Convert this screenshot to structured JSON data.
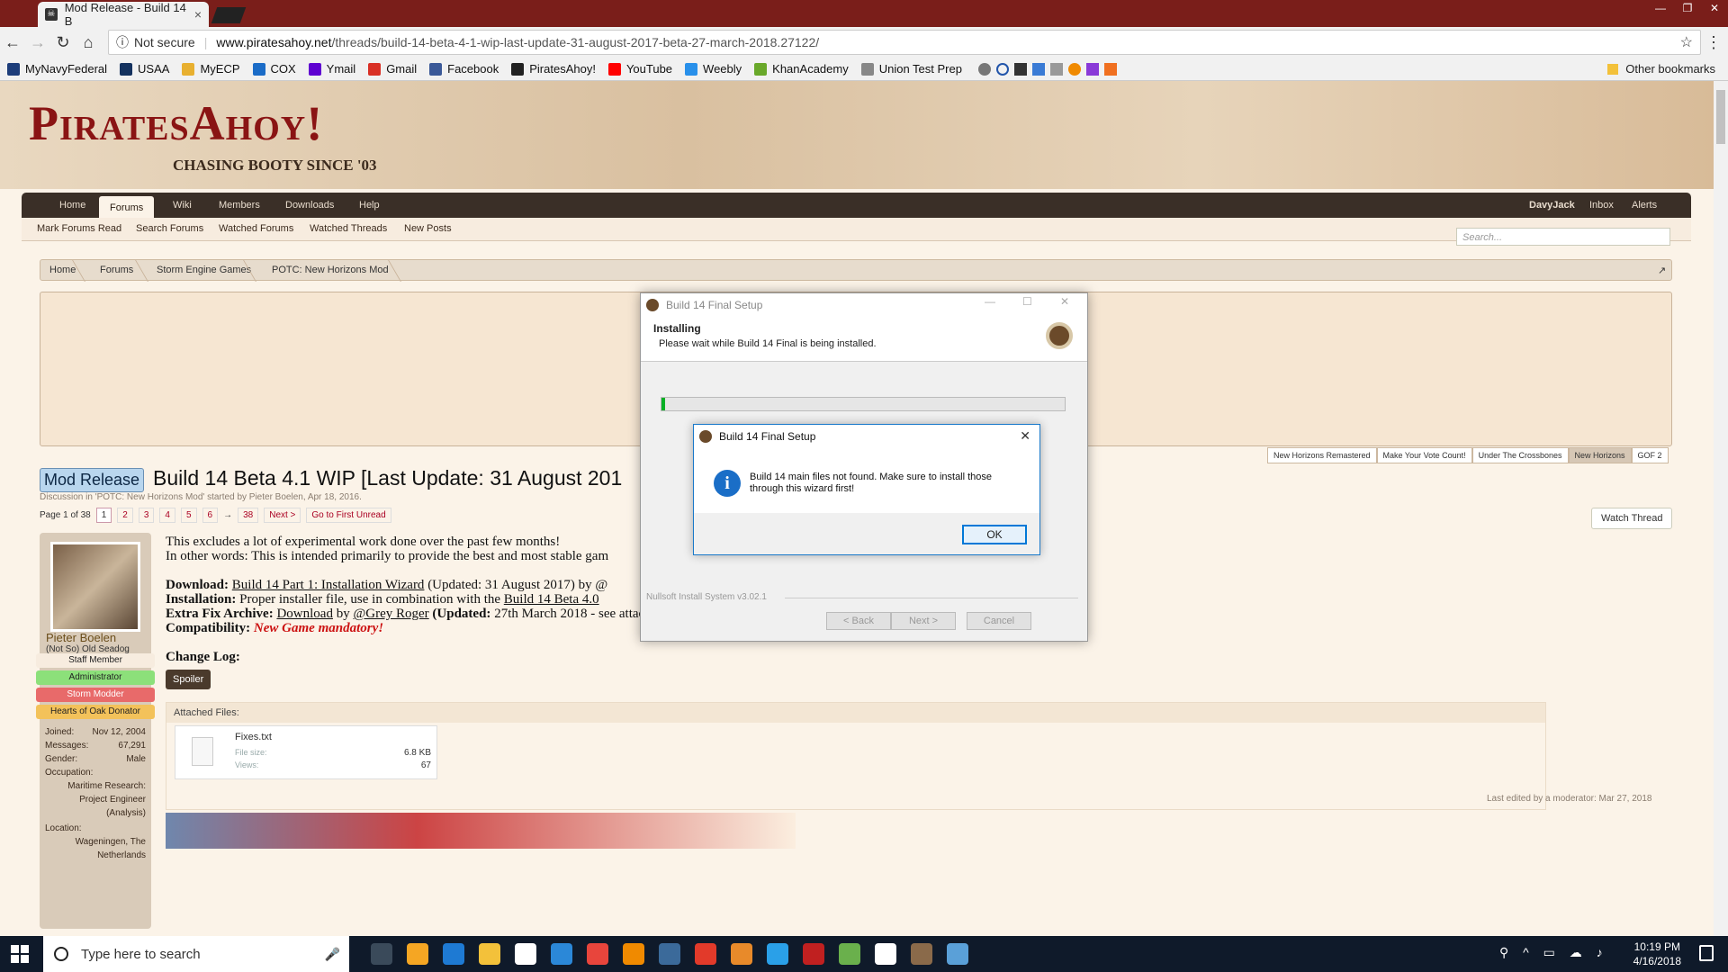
{
  "browser": {
    "tab_title": "Mod Release - Build 14 B",
    "security": "Not secure",
    "url_domain": "www.piratesahoy.net",
    "url_path": "/threads/build-14-beta-4-1-wip-last-update-31-august-2017-beta-27-march-2018.27122/",
    "bookmarks": [
      {
        "label": "MyNavyFederal",
        "color": "#1d3d7a"
      },
      {
        "label": "USAA",
        "color": "#14325f"
      },
      {
        "label": "MyECP",
        "color": "#e8b030"
      },
      {
        "label": "COX",
        "color": "#1b6cc7"
      },
      {
        "label": "Ymail",
        "color": "#5f01d1"
      },
      {
        "label": "Gmail",
        "color": "#d93025"
      },
      {
        "label": "Facebook",
        "color": "#3b5998"
      },
      {
        "label": "PiratesAhoy!",
        "color": "#222222"
      },
      {
        "label": "YouTube",
        "color": "#ff0000"
      },
      {
        "label": "Weebly",
        "color": "#2990ea"
      },
      {
        "label": "KhanAcademy",
        "color": "#69a82a"
      },
      {
        "label": "Union Test Prep",
        "color": "#888888"
      }
    ],
    "other_bookmarks": "Other bookmarks"
  },
  "site": {
    "logo": "PiratesAhoy!",
    "tagline": "CHASING BOOTY SINCE '03",
    "nav": [
      "Home",
      "Forums",
      "Wiki",
      "Members",
      "Downloads",
      "Help"
    ],
    "active_nav": "Forums",
    "user_nav": [
      "DavyJack",
      "Inbox",
      "Alerts"
    ],
    "subnav": [
      "Mark Forums Read",
      "Search Forums",
      "Watched Forums",
      "Watched Threads",
      "New Posts"
    ],
    "search_placeholder": "Search...",
    "breadcrumbs": [
      "Home",
      "Forums",
      "Storm Engine Games",
      "POTC: New Horizons Mod"
    ],
    "ad_tabs": [
      "New Horizons Remastered",
      "Make Your Vote Count!",
      "Under The Crossbones",
      "New Horizons",
      "GOF 2"
    ]
  },
  "thread": {
    "prefix": "Mod Release",
    "title": "Build 14 Beta 4.1 WIP [Last Update: 31 August 201",
    "discussion": "Discussion in 'POTC: New Horizons Mod' started by Pieter Boelen, Apr 18, 2016.",
    "page_label": "Page 1 of 38",
    "pages": [
      "1",
      "2",
      "3",
      "4",
      "5",
      "6",
      "→",
      "38"
    ],
    "next": "Next >",
    "first_unread": "Go to First Unread",
    "watch": "Watch Thread"
  },
  "user": {
    "name": "Pieter Boelen",
    "title": "(Not So) Old Seadog",
    "badges": [
      {
        "label": "Staff Member",
        "color": "#f7ecdf"
      },
      {
        "label": "Administrator",
        "color": "#8ce07a"
      },
      {
        "label": "Storm Modder",
        "color": "#e86a6a"
      },
      {
        "label": "Hearts of Oak Donator",
        "color": "#f3c25a"
      }
    ],
    "joined_k": "Joined:",
    "joined_v": "Nov 12, 2004",
    "messages_k": "Messages:",
    "messages_v": "67,291",
    "gender_k": "Gender:",
    "gender_v": "Male",
    "occupation_k": "Occupation:",
    "occupation_v": "Maritime Research: Project Engineer (Analysis)",
    "location_k": "Location:",
    "location_v": "Wageningen, The Netherlands"
  },
  "post": {
    "line1": "This excludes a lot of experimental work done over the past few months!",
    "line2": "In other words: This is intended primarily to provide the best and most stable gam",
    "download_k": "Download:",
    "download_link": "Build 14 Part 1: Installation Wizard",
    "download_rest": " (Updated: 31 August 2017) by @",
    "install_k": "Installation:",
    "install_rest": " Proper installer file, use in combination with the ",
    "install_link": "Build 14 Beta 4.0",
    "extra_k": "Extra Fix Archive:",
    "extra_link": "Download",
    "extra_by": " by ",
    "extra_user": "@Grey Roger",
    "extra_updated": " (Updated:",
    "extra_rest": " 27th March 2018 - see attached \"fixes.txt\" for what is included)",
    "compat_k": "Compatibility:",
    "compat_v": "New Game mandatory!",
    "changelog": "Change Log:",
    "spoiler": "Spoiler",
    "attached": "Attached Files:",
    "file_name": "Fixes.txt",
    "file_size_k": "File size:",
    "file_size_v": "6.8 KB",
    "views_k": "Views:",
    "views_v": "67",
    "edited": "Last edited by a moderator: Mar 27, 2018"
  },
  "installer": {
    "title": "Build 14 Final Setup",
    "heading": "Installing",
    "subheading": "Please wait while Build 14 Final is being installed.",
    "progress": 0.01,
    "footer": "Nullsoft Install System v3.02.1",
    "back": "< Back",
    "next": "Next >",
    "cancel": "Cancel"
  },
  "msgbox": {
    "title": "Build 14 Final Setup",
    "text": "Build 14 main files not found. Make sure to install those through this wizard first!",
    "ok": "OK"
  },
  "taskbar": {
    "search": "Type here to search",
    "time": "10:19 PM",
    "date": "4/16/2018",
    "apps": [
      {
        "name": "task-view",
        "color": "#3a4a5a"
      },
      {
        "name": "store",
        "color": "#f5a623"
      },
      {
        "name": "edge",
        "color": "#1e7ad3"
      },
      {
        "name": "file-explorer",
        "color": "#f3c13a"
      },
      {
        "name": "mail",
        "color": "#ffffff"
      },
      {
        "name": "visual-studio",
        "color": "#2b88d8"
      },
      {
        "name": "chrome",
        "color": "#e8453c"
      },
      {
        "name": "vlc",
        "color": "#f08a00"
      },
      {
        "name": "steam",
        "color": "#3b6a9a"
      },
      {
        "name": "foxit",
        "color": "#e23a2a"
      },
      {
        "name": "bonzi",
        "color": "#e88a2a"
      },
      {
        "name": "refresh-app",
        "color": "#2aa0e8"
      },
      {
        "name": "app-red",
        "color": "#c02020"
      },
      {
        "name": "bluestacks",
        "color": "#6ab04c"
      },
      {
        "name": "notepad",
        "color": "#ffffff"
      },
      {
        "name": "setup",
        "color": "#8a6a4a"
      },
      {
        "name": "paint",
        "color": "#5aa0d8"
      }
    ]
  }
}
